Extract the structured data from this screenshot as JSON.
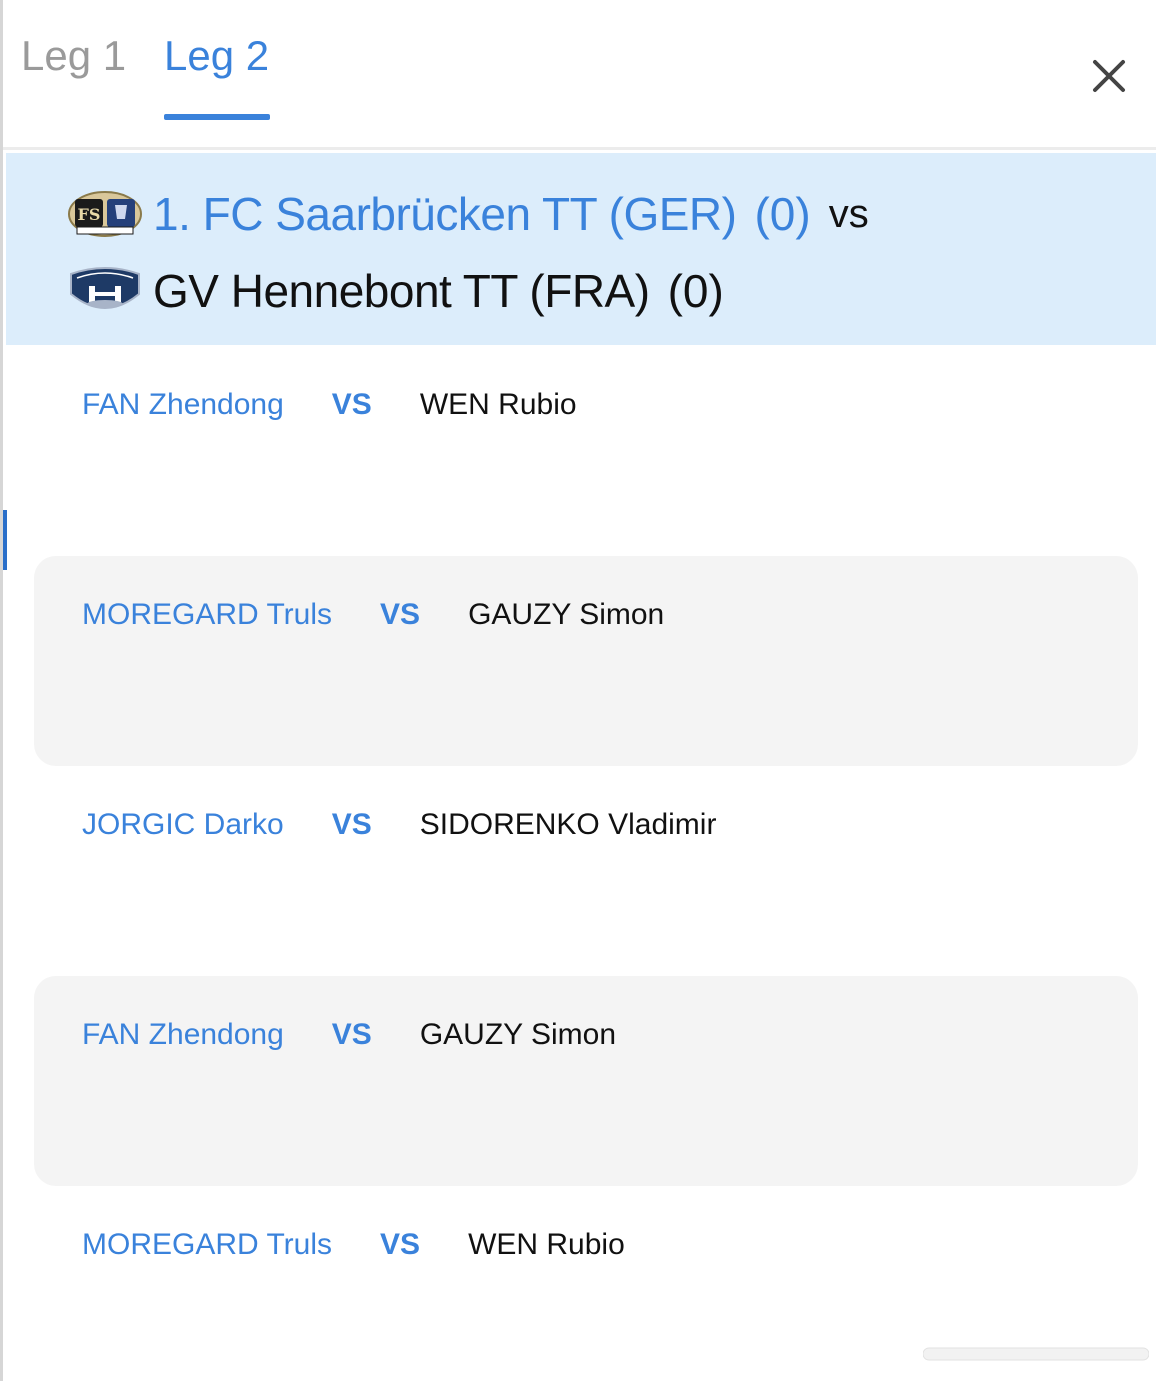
{
  "tabs": [
    {
      "label": "Leg 1",
      "active": false
    },
    {
      "label": "Leg 2",
      "active": true
    }
  ],
  "close_icon": "close-icon",
  "fixture": {
    "home": {
      "name": "1. FC Saarbrücken TT (GER)",
      "score": "(0)",
      "logo": "saarbruecken-crest"
    },
    "vs_label": "vs",
    "away": {
      "name": "GV Hennebont TT (FRA)",
      "score": "(0)",
      "logo": "hennebont-crest"
    }
  },
  "matches": [
    {
      "home": "FAN Zhendong",
      "vs": "VS",
      "away": "WEN Rubio"
    },
    {
      "home": "MOREGARD Truls",
      "vs": "VS",
      "away": "GAUZY Simon"
    },
    {
      "home": "JORGIC Darko",
      "vs": "VS",
      "away": "SIDORENKO Vladimir"
    },
    {
      "home": "FAN Zhendong",
      "vs": "VS",
      "away": "GAUZY Simon"
    },
    {
      "home": "MOREGARD Truls",
      "vs": "VS",
      "away": "WEN Rubio"
    }
  ],
  "colors": {
    "accent": "#3a82db",
    "header_band": "#dcedfb",
    "row_shade": "#f4f4f4",
    "inactive_tab": "#9a9a9a"
  }
}
